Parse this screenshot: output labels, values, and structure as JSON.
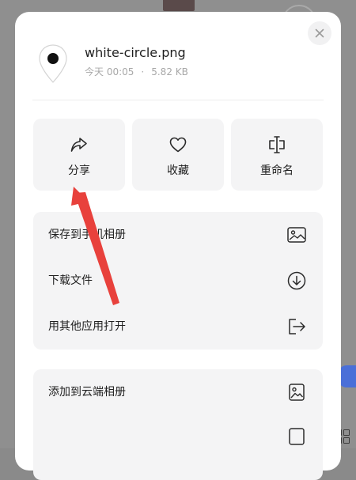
{
  "file": {
    "name": "white-circle.png",
    "date": "今天 00:05",
    "separator": "·",
    "size": "5.82 KB"
  },
  "actions": [
    {
      "label": "分享",
      "icon": "share-icon"
    },
    {
      "label": "收藏",
      "icon": "heart-icon"
    },
    {
      "label": "重命名",
      "icon": "rename-icon"
    }
  ],
  "menu_group_1": [
    {
      "label": "保存到手机相册",
      "icon": "image-icon"
    },
    {
      "label": "下载文件",
      "icon": "download-icon"
    },
    {
      "label": "用其他应用打开",
      "icon": "open-external-icon"
    }
  ],
  "menu_group_2": [
    {
      "label": "添加到云端相册",
      "icon": "image-icon"
    }
  ],
  "colors": {
    "annotation_arrow": "#e8413c",
    "sheet_background": "#ffffff",
    "card_background": "#f4f4f5"
  }
}
